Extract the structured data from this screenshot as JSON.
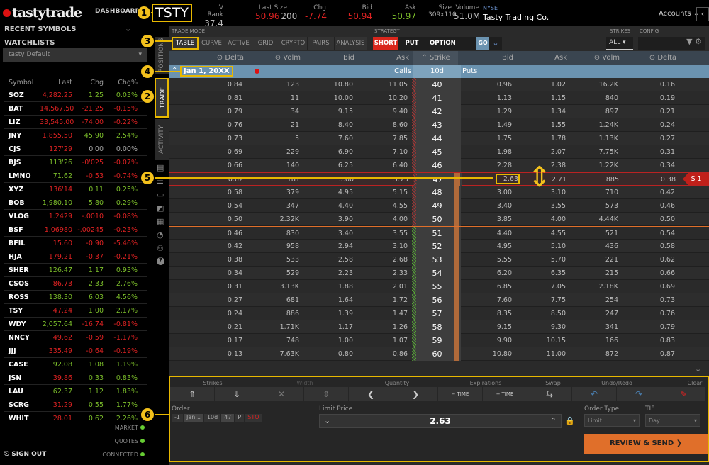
{
  "header": {
    "logo": "tastytrade",
    "dashboard": "DASHBOARD",
    "symbol": "TSTY",
    "quotes": [
      {
        "label": "IV Rank",
        "value": "37.4"
      },
      {
        "label": "Last Size",
        "value": "50.96",
        "extra": "200"
      },
      {
        "label": "Chg",
        "value": "-7.74"
      },
      {
        "label": "Bid",
        "value": "50.94"
      },
      {
        "label": "Ask",
        "value": "50.97"
      },
      {
        "label": "Size",
        "value": "309x110"
      },
      {
        "label": "Volume",
        "value": "51.0M"
      }
    ],
    "exchange": "NYSE",
    "company": "Tasty Trading Co.",
    "accounts": "Accounts"
  },
  "sidebar": {
    "recent": "RECENT SYMBOLS",
    "watchlists": "WATCHLISTS",
    "selected_list": "tasty Default",
    "columns": [
      "Symbol",
      "Last",
      "Chg",
      "Chg%"
    ],
    "rows": [
      [
        "SOZ",
        "4,282.25",
        "1.25",
        "0.03%",
        "r",
        "g",
        "g"
      ],
      [
        "BAT",
        "14,567.50",
        "-21.25",
        "-0.15%",
        "r",
        "r",
        "r"
      ],
      [
        "LIZ",
        "33,545.00",
        "-74.00",
        "-0.22%",
        "r",
        "r",
        "r"
      ],
      [
        "JNY",
        "1,855.50",
        "45.90",
        "2.54%",
        "r",
        "g",
        "g"
      ],
      [
        "CJS",
        "127'29",
        "0'00",
        "0.00%",
        "r",
        "n",
        "n"
      ],
      [
        "BJS",
        "113'26",
        "-0'025",
        "-0.07%",
        "g",
        "r",
        "r"
      ],
      [
        "LMNO",
        "71.62",
        "-0.53",
        "-0.74%",
        "g",
        "r",
        "r"
      ],
      [
        "XYZ",
        "136'14",
        "0'11",
        "0.25%",
        "r",
        "g",
        "g"
      ],
      [
        "BOB",
        "1,980.10",
        "5.80",
        "0.29%",
        "g",
        "g",
        "g"
      ],
      [
        "VLOG",
        "1.2429",
        "-.0010",
        "-0.08%",
        "r",
        "r",
        "r"
      ],
      [
        "BSF",
        "1.06980",
        "-.00245",
        "-0.23%",
        "r",
        "r",
        "r"
      ],
      [
        "BFIL",
        "15.60",
        "-0.90",
        "-5.46%",
        "r",
        "r",
        "r"
      ],
      [
        "HJA",
        "179.21",
        "-0.37",
        "-0.21%",
        "r",
        "r",
        "r"
      ],
      [
        "SHER",
        "126.47",
        "1.17",
        "0.93%",
        "g",
        "g",
        "g"
      ],
      [
        "CSOS",
        "86.73",
        "2.33",
        "2.76%",
        "r",
        "g",
        "g"
      ],
      [
        "ROSS",
        "138.30",
        "6.03",
        "4.56%",
        "g",
        "g",
        "g"
      ],
      [
        "TSY",
        "47.24",
        "1.00",
        "2.17%",
        "r",
        "g",
        "g"
      ],
      [
        "WDY",
        "2,057.64",
        "-16.74",
        "-0.81%",
        "g",
        "r",
        "r"
      ],
      [
        "NNCY",
        "49.62",
        "-0.59",
        "-1.17%",
        "r",
        "r",
        "r"
      ],
      [
        "JJJ",
        "335.49",
        "-0.64",
        "-0.19%",
        "r",
        "r",
        "r"
      ],
      [
        "CASE",
        "92.08",
        "1.08",
        "1.19%",
        "g",
        "g",
        "g"
      ],
      [
        "JSN",
        "39.86",
        "0.33",
        "0.83%",
        "r",
        "g",
        "g"
      ],
      [
        "LAU",
        "62.37",
        "1.12",
        "1.83%",
        "g",
        "g",
        "g"
      ],
      [
        "SCRG",
        "31.29",
        "0.55",
        "1.77%",
        "r",
        "g",
        "g"
      ],
      [
        "WHIT",
        "28.01",
        "0.62",
        "2.26%",
        "r",
        "g",
        "g"
      ]
    ],
    "status": [
      "MARKET",
      "QUOTES",
      "CONNECTED"
    ],
    "sign_out": "SIGN OUT"
  },
  "vtabs": [
    "POSITIONS",
    "TRADE",
    "ACTIVITY"
  ],
  "trade": {
    "mode_label": "TRADE MODE",
    "modes": [
      "TABLE",
      "CURVE",
      "ACTIVE",
      "GRID",
      "CRYPTO",
      "PAIRS",
      "ANALYSIS"
    ],
    "strategy_label": "STRATEGY",
    "strategy": [
      "SHORT",
      "PUT",
      "OPTION"
    ],
    "go": "GO",
    "strikes_label": "STRIKES",
    "strikes_value": "ALL",
    "config_label": "CONFIG",
    "columns": [
      "Delta",
      "Volm",
      "Bid",
      "Ask",
      "Strike",
      "Bid",
      "Ask",
      "Volm",
      "Delta"
    ],
    "expiration": "Jan 1, 20XX",
    "calls": "Calls",
    "dte": "10d",
    "puts": "Puts",
    "position_tag": "S 1",
    "rows": [
      [
        "0.84",
        "123",
        "10.80",
        "11.05",
        "40",
        "0.96",
        "1.02",
        "16.2K",
        "0.16"
      ],
      [
        "0.81",
        "11",
        "10.00",
        "10.20",
        "41",
        "1.13",
        "1.15",
        "840",
        "0.19"
      ],
      [
        "0.79",
        "34",
        "9.15",
        "9.40",
        "42",
        "1.29",
        "1.34",
        "897",
        "0.21"
      ],
      [
        "0.76",
        "21",
        "8.40",
        "8.60",
        "43",
        "1.49",
        "1.55",
        "1.24K",
        "0.24"
      ],
      [
        "0.73",
        "5",
        "7.60",
        "7.85",
        "44",
        "1.75",
        "1.78",
        "1.13K",
        "0.27"
      ],
      [
        "0.69",
        "229",
        "6.90",
        "7.10",
        "45",
        "1.98",
        "2.07",
        "7.75K",
        "0.31"
      ],
      [
        "0.66",
        "140",
        "6.25",
        "6.40",
        "46",
        "2.28",
        "2.38",
        "1.22K",
        "0.34"
      ],
      [
        "0.62",
        "181",
        "5.60",
        "5.75",
        "47",
        "2.63",
        "2.71",
        "885",
        "0.38"
      ],
      [
        "0.58",
        "379",
        "4.95",
        "5.15",
        "48",
        "3.00",
        "3.10",
        "710",
        "0.42"
      ],
      [
        "0.54",
        "347",
        "4.40",
        "4.55",
        "49",
        "3.40",
        "3.55",
        "573",
        "0.46"
      ],
      [
        "0.50",
        "2.32K",
        "3.90",
        "4.00",
        "50",
        "3.85",
        "4.00",
        "4.44K",
        "0.50"
      ],
      [
        "0.46",
        "830",
        "3.40",
        "3.55",
        "51",
        "4.40",
        "4.55",
        "521",
        "0.54"
      ],
      [
        "0.42",
        "958",
        "2.94",
        "3.10",
        "52",
        "4.95",
        "5.10",
        "436",
        "0.58"
      ],
      [
        "0.38",
        "533",
        "2.58",
        "2.68",
        "53",
        "5.55",
        "5.70",
        "221",
        "0.62"
      ],
      [
        "0.34",
        "529",
        "2.23",
        "2.33",
        "54",
        "6.20",
        "6.35",
        "215",
        "0.66"
      ],
      [
        "0.31",
        "3.13K",
        "1.88",
        "2.01",
        "55",
        "6.85",
        "7.05",
        "2.18K",
        "0.69"
      ],
      [
        "0.27",
        "681",
        "1.64",
        "1.72",
        "56",
        "7.60",
        "7.75",
        "254",
        "0.73"
      ],
      [
        "0.24",
        "886",
        "1.39",
        "1.47",
        "57",
        "8.35",
        "8.50",
        "247",
        "0.76"
      ],
      [
        "0.21",
        "1.71K",
        "1.17",
        "1.26",
        "58",
        "9.15",
        "9.30",
        "341",
        "0.79"
      ],
      [
        "0.17",
        "748",
        "1.00",
        "1.07",
        "59",
        "9.90",
        "10.15",
        "166",
        "0.83"
      ],
      [
        "0.13",
        "7.63K",
        "0.80",
        "0.86",
        "60",
        "10.80",
        "11.00",
        "872",
        "0.87"
      ]
    ]
  },
  "order": {
    "sections": [
      "Strikes",
      "Width",
      "Quantity",
      "Expirations",
      "Swap",
      "Undo/Redo",
      "Clear"
    ],
    "order_label": "Order",
    "leg": [
      "-1",
      "Jan 1",
      "10d",
      "47",
      "P",
      "STO"
    ],
    "limit_label": "Limit Price",
    "limit_price": "2.63",
    "order_type_label": "Order Type",
    "order_type": "Limit",
    "tif_label": "TIF",
    "tif": "Day",
    "review": "REVIEW & SEND ❯",
    "time": "TIME"
  },
  "callouts": [
    "1",
    "2",
    "3",
    "4",
    "5",
    "6"
  ],
  "colors": {
    "accent": "#e8b800",
    "short": "#d9261c",
    "review": "#e06f2a",
    "expiration": "#6b93b0"
  }
}
